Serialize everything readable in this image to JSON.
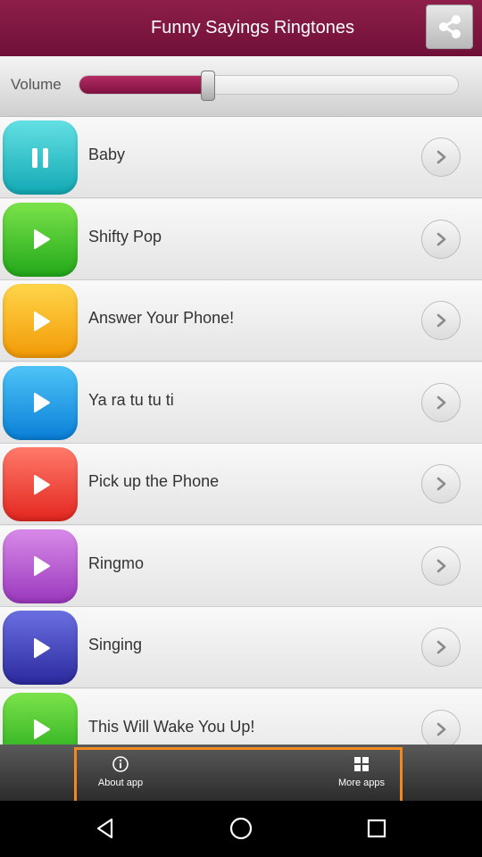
{
  "app": {
    "title": "Funny Sayings Ringtones"
  },
  "header": {
    "share_icon": "share-icon"
  },
  "volume": {
    "label": "Volume",
    "level_fraction": 0.34
  },
  "colors": {
    "header": "#7b163f",
    "accent": "#f08a1e"
  },
  "ringtones": [
    {
      "name": "Baby",
      "state": "playing",
      "color_top": "#63e0e3",
      "color_bottom": "#12a9b4"
    },
    {
      "name": "Shifty Pop",
      "state": "stopped",
      "color_top": "#7be34a",
      "color_bottom": "#22a81a"
    },
    {
      "name": "Answer Your Phone!",
      "state": "stopped",
      "color_top": "#ffd54a",
      "color_bottom": "#f29a06"
    },
    {
      "name": "Ya ra tu tu ti",
      "state": "stopped",
      "color_top": "#4ec4f8",
      "color_bottom": "#0a7fd7"
    },
    {
      "name": "Pick up the Phone",
      "state": "stopped",
      "color_top": "#ff7a6a",
      "color_bottom": "#e3261f"
    },
    {
      "name": "Ringmo",
      "state": "stopped",
      "color_top": "#d88ae8",
      "color_bottom": "#9a38bd"
    },
    {
      "name": "Singing",
      "state": "stopped",
      "color_top": "#6a6fe0",
      "color_bottom": "#2b2a9e"
    },
    {
      "name": "This Will Wake You Up!",
      "state": "stopped",
      "color_top": "#7be34a",
      "color_bottom": "#22a81a"
    }
  ],
  "bottom_bar": {
    "about": {
      "label": "About app",
      "icon": "info-icon"
    },
    "more": {
      "label": "More apps",
      "icon": "grid-icon"
    }
  },
  "navigation": {
    "back": "back-icon",
    "home": "home-icon",
    "recents": "recents-icon"
  }
}
